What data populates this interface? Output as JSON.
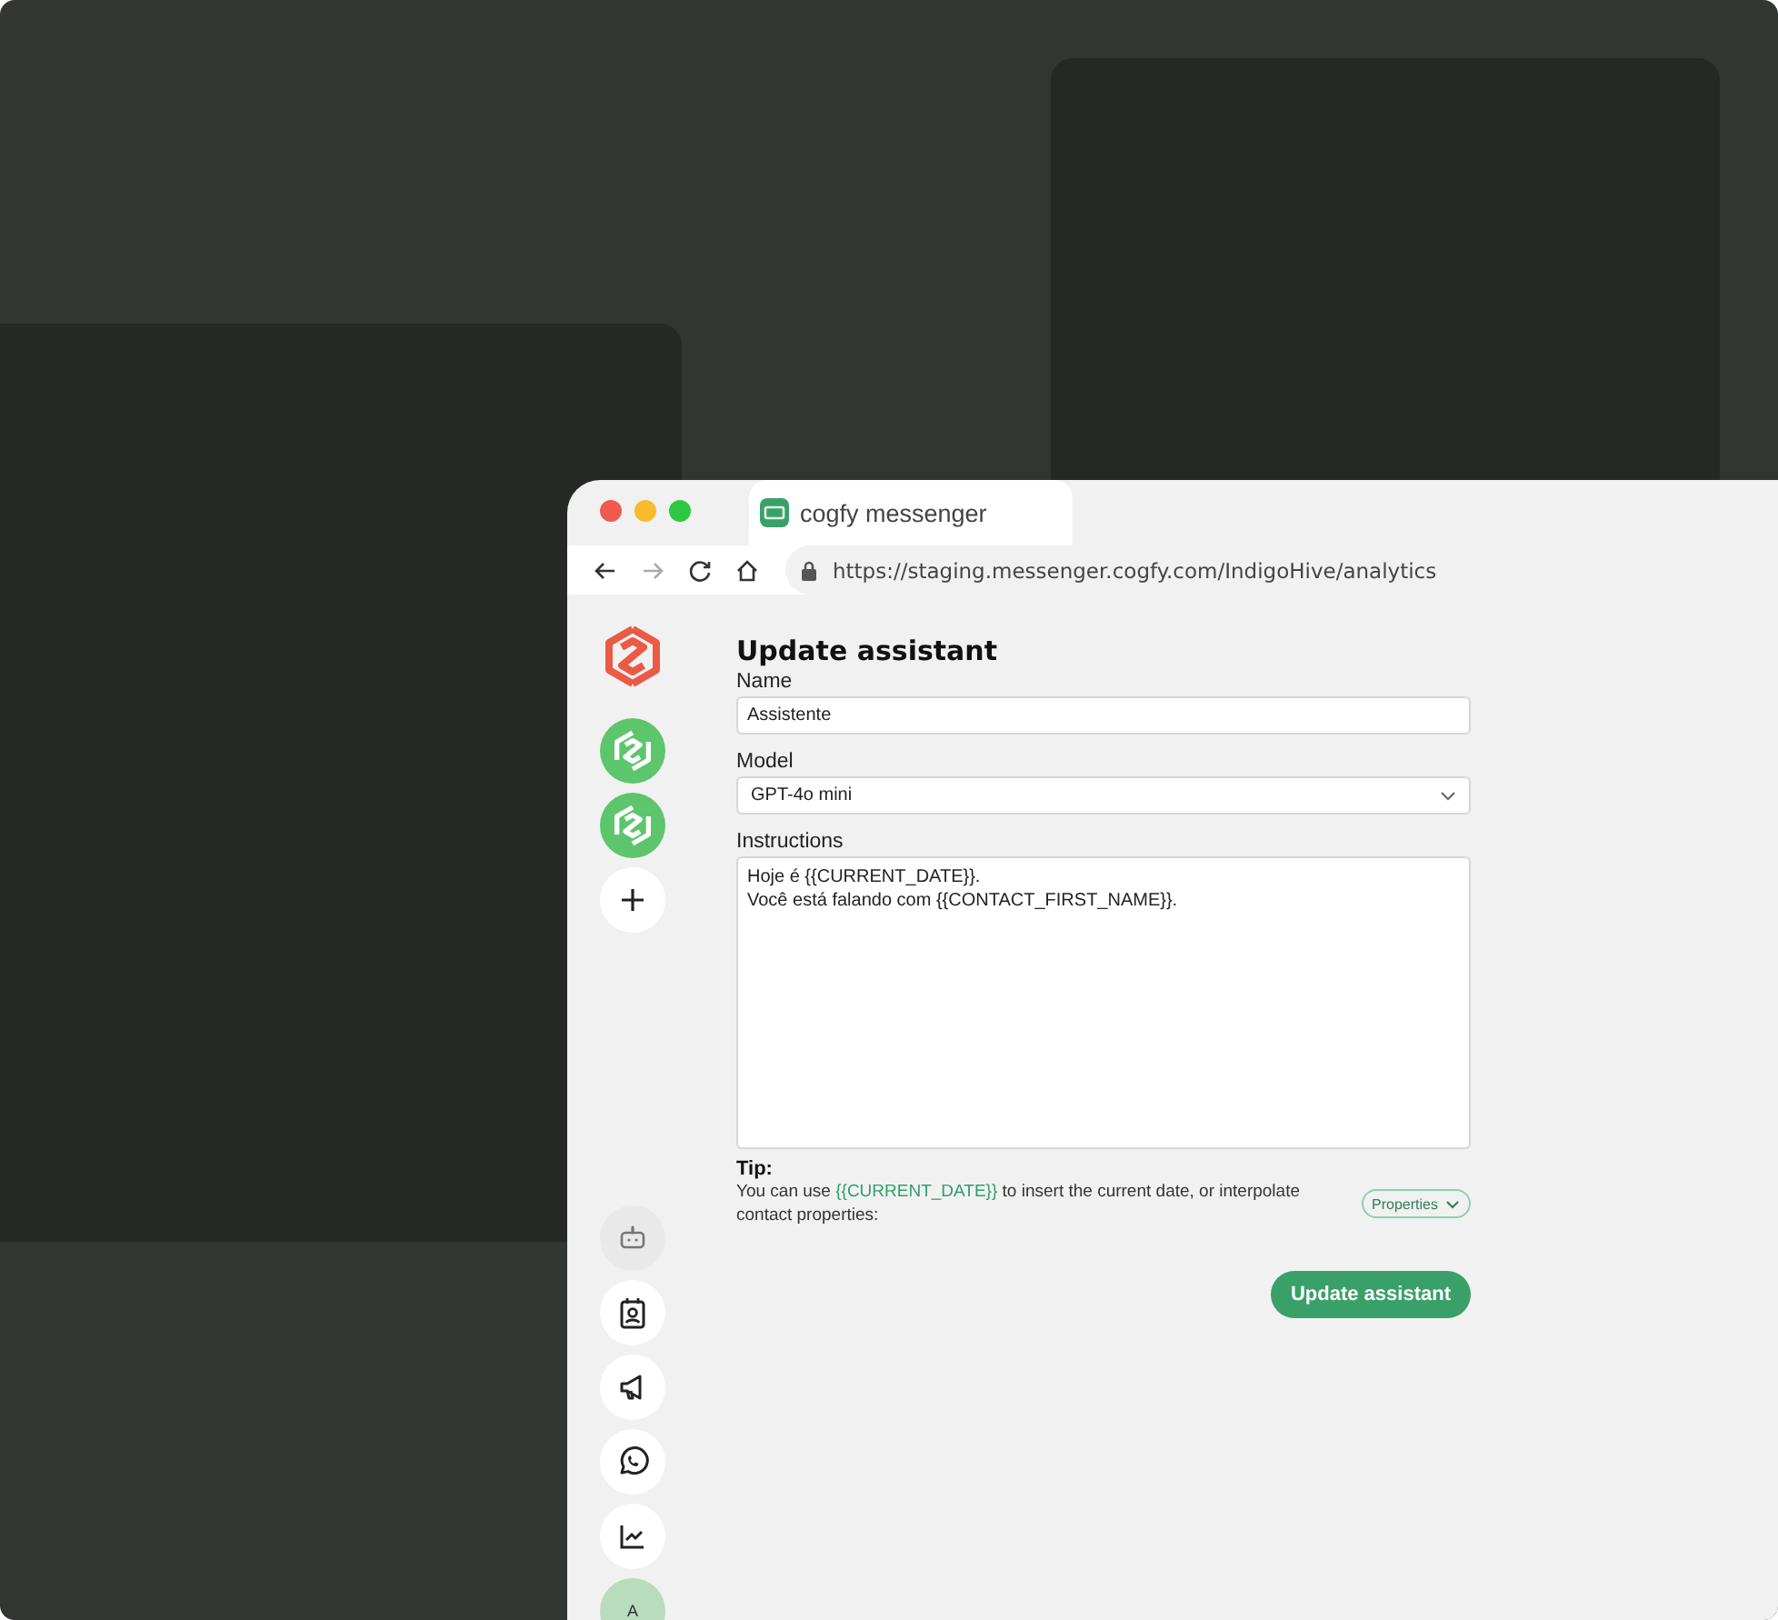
{
  "browser": {
    "tab": {
      "title": "cogfy messenger"
    },
    "url": "https://staging.messenger.cogfy.com/IndigoHive/analytics"
  },
  "sidebar": {
    "items": [
      {
        "kind": "logo"
      },
      {
        "kind": "workspace"
      },
      {
        "kind": "workspace"
      },
      {
        "kind": "add"
      },
      {
        "kind": "bot",
        "selected": true
      },
      {
        "kind": "contact",
        "selected": false
      },
      {
        "kind": "megaphone",
        "selected": false
      },
      {
        "kind": "whatsapp",
        "selected": false
      },
      {
        "kind": "chart",
        "selected": false
      },
      {
        "kind": "avatar",
        "initial": "A"
      }
    ]
  },
  "form": {
    "title": "Update assistant",
    "name": {
      "label": "Name",
      "value": "Assistente"
    },
    "model": {
      "label": "Model",
      "value": "GPT-4o mini"
    },
    "instructions": {
      "label": "Instructions",
      "value": "Hoje é {{CURRENT_DATE}}.\nVocê está falando com {{CONTACT_FIRST_NAME}}."
    },
    "tip": {
      "title": "Tip:",
      "text": [
        {
          "kind": "plain",
          "text": "You can use "
        },
        {
          "kind": "variable",
          "text": "{{CURRENT_DATE}}"
        },
        {
          "kind": "plain",
          "text": " to insert the current date, or interpolate contact properties:"
        }
      ],
      "button": "Properties"
    },
    "submit": "Update assistant"
  }
}
